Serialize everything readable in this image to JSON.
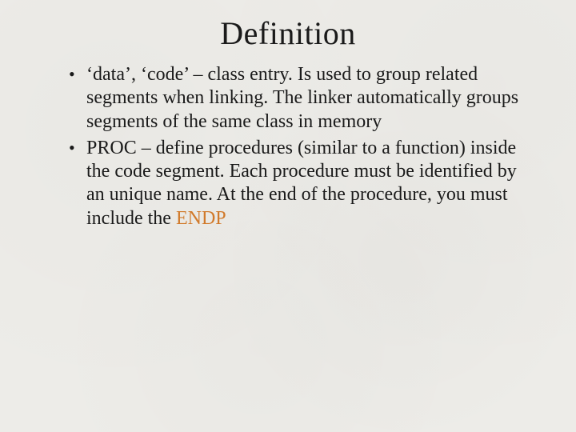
{
  "title": "Definition",
  "bullets": [
    {
      "text_before": "‘data’, ‘code’ – class entry. Is used to group related segments when linking. The linker automatically groups segments of the same class in memory",
      "highlight": "",
      "text_after": ""
    },
    {
      "text_before": "PROC – define procedures (similar to a function) inside the code segment. Each procedure must be identified by an unique name. At the end of the procedure, you must include the ",
      "highlight": "ENDP",
      "text_after": ""
    }
  ],
  "colors": {
    "background": "#edece8",
    "text": "#1a1a1a",
    "highlight": "#d17a2b"
  }
}
